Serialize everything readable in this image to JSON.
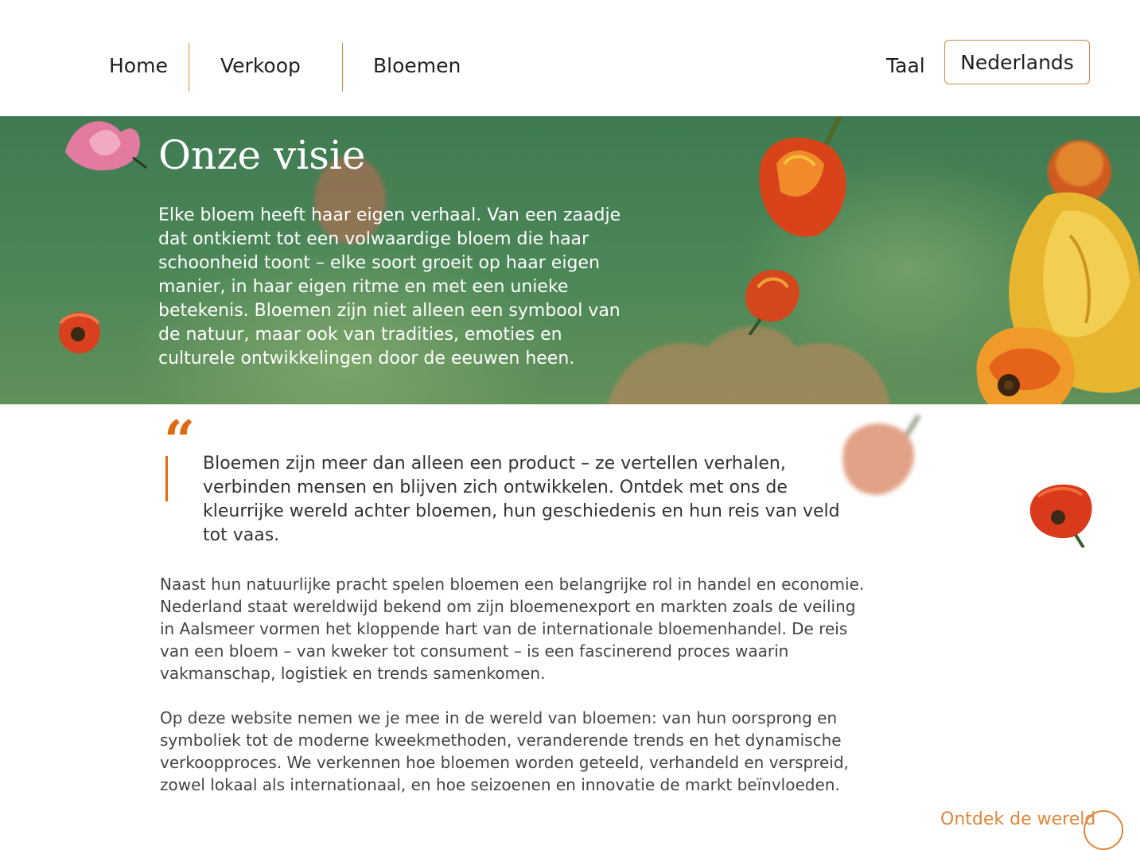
{
  "nav": {
    "items": [
      {
        "label": "Home"
      },
      {
        "label": "Verkoop"
      },
      {
        "label": "Bloemen"
      }
    ],
    "language_label": "Taal",
    "language_value": "Nederlands"
  },
  "hero": {
    "title": "Onze visie",
    "text": "Elke bloem heeft haar eigen verhaal. Van een zaadje dat ontkiemt tot een volwaardige bloem die haar schoonheid toont – elke soort groeit op haar eigen manier, in haar eigen ritme en met een unieke betekenis. Bloemen zijn niet alleen een symbool van de natuur, maar ook van tradities, emoties en culturele ontwikkelingen door de eeuwen heen."
  },
  "quote": {
    "mark": "“",
    "text": "Bloemen zijn meer dan alleen een product – ze vertellen verhalen, verbinden mensen en blijven zich ontwikkelen. Ontdek met ons de kleurrijke wereld achter bloemen, hun geschiedenis en hun reis van veld tot vaas."
  },
  "body": {
    "paragraph1": "Naast hun natuurlijke pracht spelen bloemen een belangrijke rol in handel en economie. Nederland staat wereldwijd bekend om zijn bloemenexport en markten zoals de veiling in Aalsmeer vormen het kloppende hart van de internationale bloemenhandel. De reis van een bloem – van kweker tot consument – is een fascinerend proces waarin vakmanschap, logistiek en trends samenkomen.",
    "paragraph2": "Op deze website nemen we je mee in de wereld van bloemen: van hun oorsprong en symboliek tot de moderne kweekmethoden, veranderende trends en het dynamische verkoopproces. We verkennen hoe bloemen worden geteeld, verhandeld en verspreid, zowel lokaal als internationaal, en hoe seizoenen en innovatie de markt beïnvloeden."
  },
  "footer_link": {
    "label": "Ontdek de wereld"
  },
  "colors": {
    "accent": "#e06a10",
    "nav_border": "#d98a3a",
    "hero_green": "#4c8758"
  }
}
